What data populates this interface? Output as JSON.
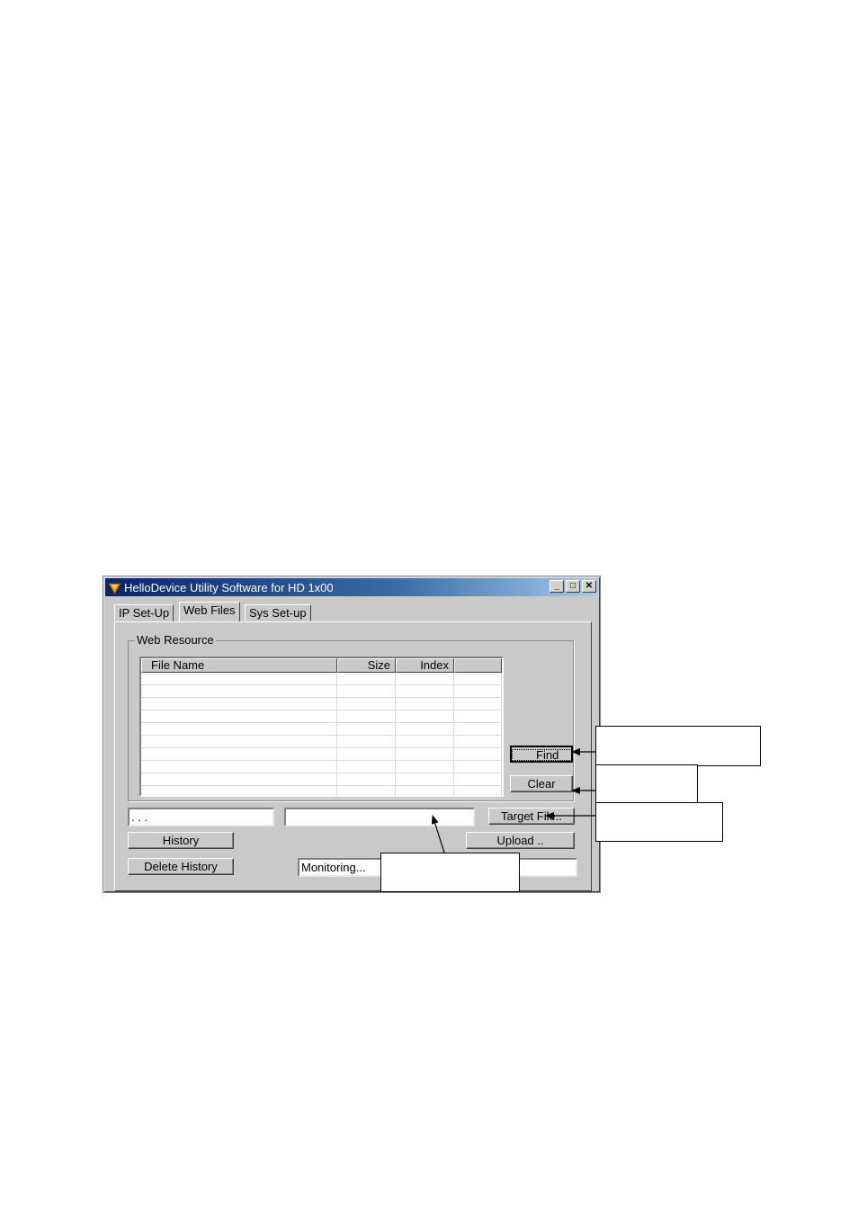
{
  "window": {
    "title": "HelloDevice Utility Software for HD 1x00",
    "controls": {
      "minimize": "_",
      "maximize": "□",
      "close": "✕"
    }
  },
  "tabs": [
    {
      "label": "IP Set-Up",
      "active": false
    },
    {
      "label": "Web Files",
      "active": true
    },
    {
      "label": "Sys Set-up",
      "active": false
    }
  ],
  "web_resource": {
    "group_label": "Web Resource",
    "columns": [
      "File Name",
      "Size",
      "Index",
      ""
    ],
    "row_count": 10
  },
  "buttons": {
    "find": "Find",
    "clear": "Clear",
    "target_file": "Target File..",
    "history": "History",
    "upload": "Upload ..",
    "delete_history": "Delete History"
  },
  "fields": {
    "ip_address": ".       .       .",
    "target_path": "",
    "status": "Monitoring..."
  },
  "icons": {
    "app": "hellodevice-logo-icon"
  },
  "colors": {
    "titlebar_start": "#0a246a",
    "titlebar_end": "#a6caf0",
    "face": "#c9c9c9"
  }
}
